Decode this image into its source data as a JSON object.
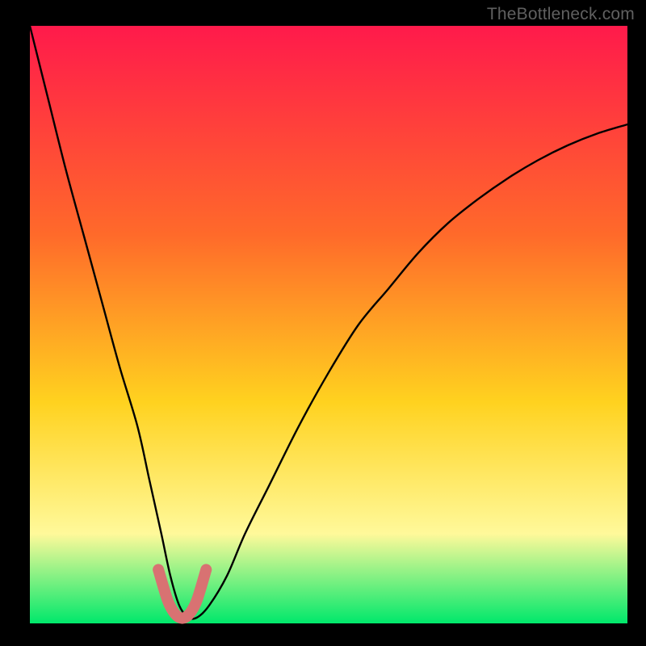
{
  "watermark": "TheBottleneck.com",
  "colors": {
    "background": "#000000",
    "gradient_top": "#ff1a4b",
    "gradient_mid1": "#ff6a2a",
    "gradient_mid2": "#ffd21f",
    "gradient_mid3": "#fff99a",
    "gradient_bottom": "#00e86b",
    "curve": "#000000",
    "highlight": "#d87272"
  },
  "chart_data": {
    "type": "line",
    "title": "",
    "xlabel": "",
    "ylabel": "",
    "xlim": [
      0,
      100
    ],
    "ylim": [
      0,
      100
    ],
    "series": [
      {
        "name": "bottleneck-curve",
        "x": [
          0,
          3,
          6,
          9,
          12,
          15,
          18,
          20,
          22,
          23.5,
          25,
          26.5,
          28,
          30,
          33,
          36,
          40,
          45,
          50,
          55,
          60,
          65,
          70,
          75,
          80,
          85,
          90,
          95,
          100
        ],
        "values": [
          100,
          88,
          76,
          65,
          54,
          43,
          33,
          24,
          15,
          8,
          3,
          1,
          1,
          3,
          8,
          15,
          23,
          33,
          42,
          50,
          56,
          62,
          67,
          71,
          74.5,
          77.5,
          80,
          82,
          83.5
        ]
      },
      {
        "name": "highlight-segment",
        "x": [
          21.5,
          23,
          24,
          25,
          26,
          27,
          28,
          29.5
        ],
        "values": [
          9,
          4,
          2,
          1,
          1,
          2,
          4,
          9
        ]
      }
    ],
    "minimum_x": 25.5,
    "annotations": []
  }
}
